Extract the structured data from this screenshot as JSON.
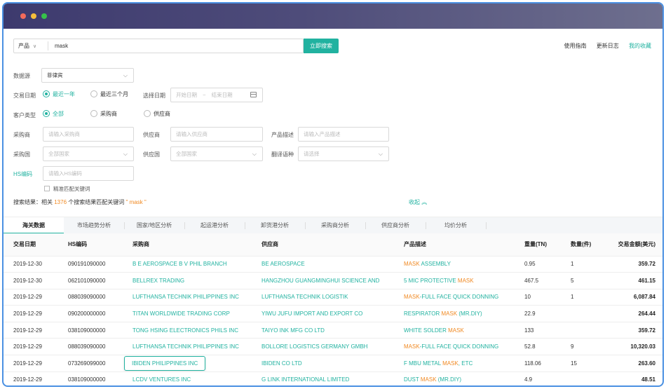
{
  "search": {
    "type_label": "产品",
    "query": "mask",
    "button_label": "立即搜索",
    "links": [
      "使用指南",
      "更新日志",
      "我的收藏"
    ]
  },
  "filters": {
    "datasource_label": "数据源",
    "datasource_value": "菲律宾",
    "trade_date_label": "交易日期",
    "trade_date_options": [
      "最近一年",
      "最近三个月"
    ],
    "select_date_label": "选择日期",
    "start_date_placeholder": "开始日期",
    "date_separator": "~",
    "end_date_placeholder": "结束日期",
    "customer_type_label": "客户类型",
    "customer_type_options": [
      "全部",
      "采购商",
      "供应商"
    ],
    "buyer_label": "采购商",
    "buyer_placeholder": "请输入采购商",
    "supplier_label": "供应商",
    "supplier_placeholder": "请输入供应商",
    "product_desc_label": "产品描述",
    "product_desc_placeholder": "请输入产品描述",
    "buyer_country_label": "采购国",
    "buyer_country_value": "全部国家",
    "supplier_country_label": "供应国",
    "supplier_country_value": "全部国家",
    "translate_label": "翻译语种",
    "translate_value": "请选择",
    "hs_label": "HS编码",
    "hs_placeholder": "请输入HS编码",
    "exact_match_label": "精准匹配关键词"
  },
  "result": {
    "prefix": "搜索结果：相关",
    "count": "1376",
    "middle": "个搜索结果匹配关键词",
    "keyword": "\" mask \"",
    "collapse_label": "收起 ︽"
  },
  "tabs": [
    "海关数据",
    "市场趋势分析",
    "国家/地区分析",
    "起运港分析",
    "卸货港分析",
    "采购商分析",
    "供应商分析",
    "均价分析"
  ],
  "table": {
    "headers": [
      "交易日期",
      "HS编码",
      "采购商",
      "供应商",
      "产品描述",
      "重量(TN)",
      "数量(件)",
      "交易金额(美元)"
    ],
    "rows": [
      {
        "date": "2019-12-30",
        "hs": "090191090000",
        "buyer": "B E AEROSPACE B V PHIL BRANCH",
        "supplier": "BE AEROSPACE",
        "desc_pre": "",
        "desc_hl": "MASK",
        "desc_post": " ASSEMBLY",
        "weight": "0.95",
        "qty": "1",
        "amount": "359.72"
      },
      {
        "date": "2019-12-30",
        "hs": "062101090000",
        "buyer": "BELLREX TRADING",
        "supplier": "HANGZHOU GUANGMINGHUI SCIENCE AND",
        "desc_pre": "5 MIC PROTECTIVE ",
        "desc_hl": "MASK",
        "desc_post": "",
        "weight": "467.5",
        "qty": "5",
        "amount": "461.15"
      },
      {
        "date": "2019-12-29",
        "hs": "088039090000",
        "buyer": "LUFTHANSA TECHNIK PHILIPPINES INC",
        "supplier": "LUFTHANSA TECHNIK LOGISTIK",
        "desc_pre": "",
        "desc_hl": "MASK",
        "desc_post": "-FULL FACE QUICK DONNING",
        "weight": "10",
        "qty": "1",
        "amount": "6,087.84"
      },
      {
        "date": "2019-12-29",
        "hs": "090200000000",
        "buyer": "TITAN WORLDWIDE TRADING CORP",
        "supplier": "YIWU JUFU IMPORT AND EXPORT CO",
        "desc_pre": "RESPIRATOR ",
        "desc_hl": "MASK",
        "desc_post": " (MR.DIY)",
        "weight": "22.9",
        "qty": "",
        "amount": "264.44"
      },
      {
        "date": "2019-12-29",
        "hs": "038109000000",
        "buyer": "TONG HSING ELECTRONICS PHILS INC",
        "supplier": "TAIYO INK MFG CO LTD",
        "desc_pre": "WHITE SOLDER ",
        "desc_hl": "MASK",
        "desc_post": "",
        "weight": "133",
        "qty": "",
        "amount": "359.72"
      },
      {
        "date": "2019-12-29",
        "hs": "088039090000",
        "buyer": "LUFTHANSA TECHNIK PHILIPPINES INC",
        "supplier": "BOLLORE LOGISTICS GERMANY GMBH",
        "desc_pre": "",
        "desc_hl": "MASK",
        "desc_post": "-FULL FACE QUICK DONNING",
        "weight": "52.8",
        "qty": "9",
        "amount": "10,320.03"
      },
      {
        "date": "2019-12-29",
        "hs": "073269099000",
        "buyer": "IBIDEN PHILIPPINES INC",
        "supplier": "IBIDEN CO LTD",
        "desc_pre": "F MBU METAL ",
        "desc_hl": "MASK",
        "desc_post": ", ETC",
        "weight": "118.06",
        "qty": "15",
        "amount": "263.60",
        "hover": true
      },
      {
        "date": "2019-12-29",
        "hs": "038109000000",
        "buyer": "LCDV VENTURES INC",
        "supplier": "G LINK INTERNATIONAL LIMITED",
        "desc_pre": "DUST ",
        "desc_hl": "MASK",
        "desc_post": " (MR.DIY)",
        "weight": "4.9",
        "qty": "",
        "amount": "48.51"
      }
    ]
  },
  "colors": {
    "accent": "#21b2a0",
    "highlight": "#f08a24",
    "titlebar": "#3d3a6e"
  }
}
